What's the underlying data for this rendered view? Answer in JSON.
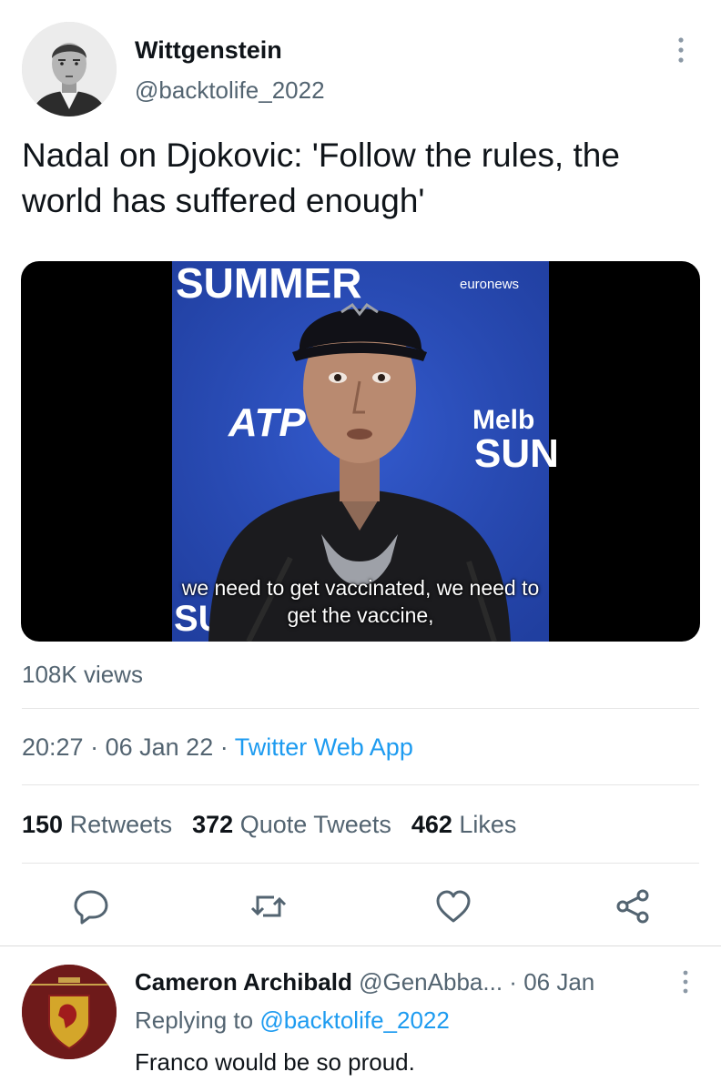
{
  "tweet": {
    "author_name": "Wittgenstein",
    "author_handle": "@backtolife_2022",
    "text": "Nadal on Djokovic: 'Follow the rules, the world has suffered enough'",
    "video": {
      "caption_line1": "we need to get vaccinated, we need to",
      "caption_line2": "get the vaccine,",
      "backdrop_text_top": "SUMMER",
      "backdrop_text_brand": "euronews",
      "backdrop_text_atp": "ATP",
      "backdrop_text_melb": "Melb",
      "backdrop_text_sun": "SUN",
      "backdrop_text_su": "SU",
      "backdrop_color": "#2a4fc0"
    },
    "views": "108K views",
    "time": "20:27",
    "date": "06 Jan 22",
    "source": "Twitter Web App",
    "separator": "·",
    "stats": {
      "retweets_count": "150",
      "retweets_label": "Retweets",
      "quotes_count": "372",
      "quotes_label": "Quote Tweets",
      "likes_count": "462",
      "likes_label": "Likes"
    },
    "actions": [
      "reply-icon",
      "retweet-icon",
      "like-icon",
      "share-icon"
    ]
  },
  "reply": {
    "author_name": "Cameron Archibald",
    "author_handle": "@GenAbba...",
    "date": "06 Jan",
    "replying_prefix": "Replying to",
    "replying_to": "@backtolife_2022",
    "text": "Franco would be so proud."
  },
  "colors": {
    "link": "#1d9bf0",
    "secondary_text": "#536471",
    "primary_text": "#0f1419"
  }
}
